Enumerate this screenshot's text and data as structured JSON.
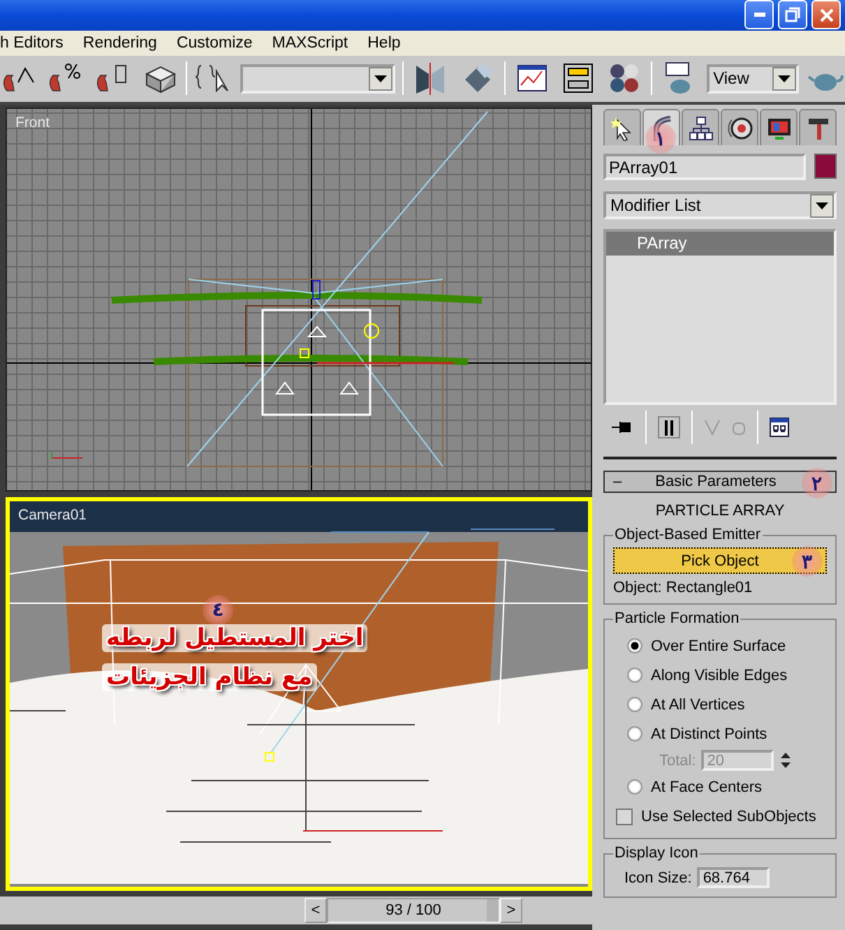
{
  "menu": {
    "items": [
      "h Editors",
      "Rendering",
      "Customize",
      "MAXScript",
      "Help"
    ]
  },
  "toolbar": {
    "view_dropdown": "View"
  },
  "viewports": [
    {
      "kind": "front",
      "label": "Front",
      "active": false
    },
    {
      "kind": "camera",
      "label": "Camera01",
      "active": true
    }
  ],
  "time_slider": {
    "prev": "<",
    "frame": "93 / 100",
    "next": ">",
    "level": 0.93
  },
  "command_panel": {
    "tabs": [
      {
        "kind": "create",
        "selected": false
      },
      {
        "kind": "modify",
        "selected": true
      },
      {
        "kind": "hierarchy",
        "selected": false
      },
      {
        "kind": "motion",
        "selected": false
      },
      {
        "kind": "display",
        "selected": false
      },
      {
        "kind": "utilities",
        "selected": false
      }
    ],
    "object_name": "PArray01",
    "modifier_list": "Modifier List",
    "stack": [
      {
        "label": "PArray",
        "selected": true
      }
    ],
    "rollout": {
      "toggle": "–",
      "title": "Basic Parameters",
      "expanded": true
    },
    "heading": "PARTICLE ARRAY",
    "emitter_group": {
      "title": "Object-Based Emitter",
      "button": "Pick Object",
      "object": "Object: Rectangle01"
    },
    "formation_group": {
      "title": "Particle Formation",
      "options": [
        {
          "label": "Over Entire Surface",
          "selected": true
        },
        {
          "label": "Along Visible Edges",
          "selected": false
        },
        {
          "label": "At All Vertices",
          "selected": false
        },
        {
          "label": "At Distinct Points",
          "selected": false
        },
        {
          "label": "At Face Centers",
          "selected": false
        }
      ],
      "total_label": "Total:",
      "total_value": "20",
      "total_disabled": true,
      "subobjects": {
        "label": "Use Selected SubObjects",
        "checked": false
      }
    },
    "display_group": {
      "title": "Display Icon",
      "size_label": "Icon Size:",
      "size_value": "68.764"
    }
  },
  "annotations": {
    "markers": [
      "١",
      "٢",
      "٣",
      "٤"
    ],
    "caption": [
      "اختر المستطيل لربطه",
      "مع نظام الجزيئات"
    ]
  }
}
